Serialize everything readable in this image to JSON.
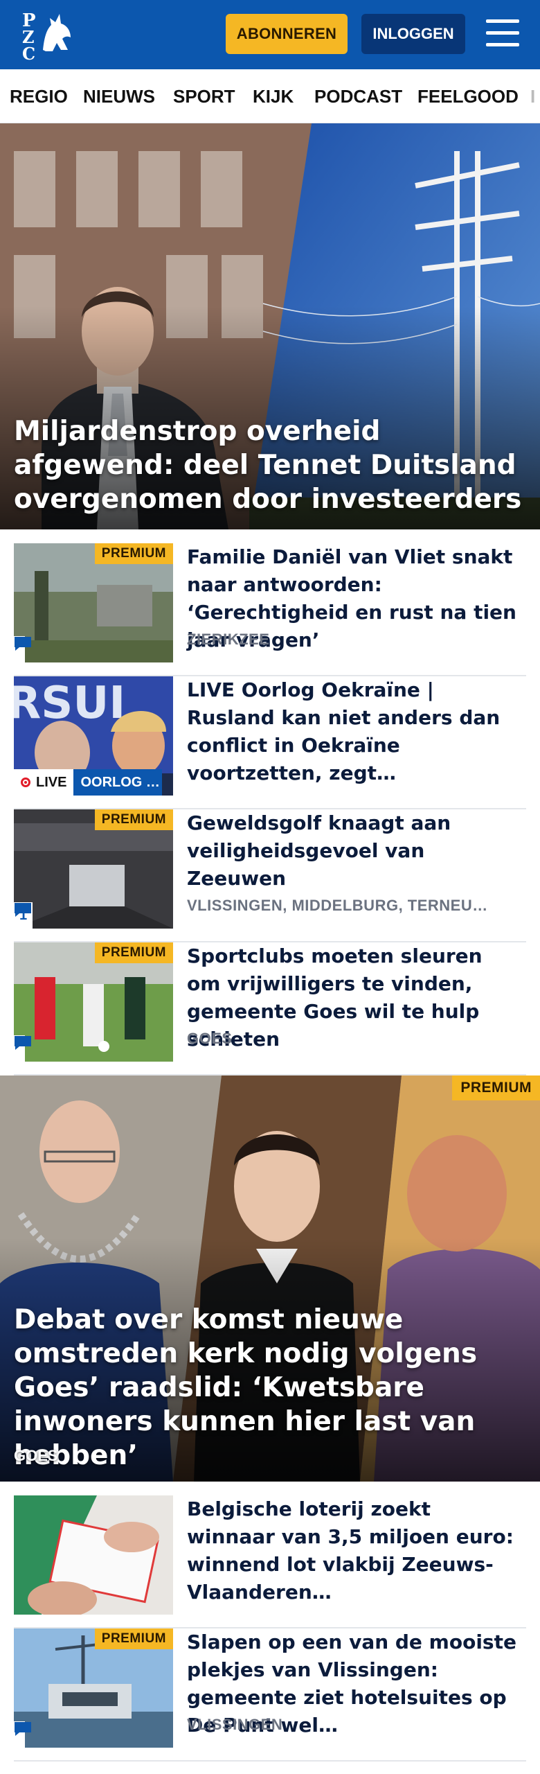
{
  "header": {
    "logo_text": "PZC",
    "subscribe_label": "ABONNEREN",
    "login_label": "INLOGGEN",
    "colors": {
      "brand": "#0c57ae",
      "accent": "#f5b724"
    }
  },
  "nav": {
    "items": [
      "REGIO",
      "NIEUWS",
      "SPORT",
      "KIJK",
      "PODCAST",
      "FEELGOOD",
      "I"
    ]
  },
  "hero1": {
    "title": "Miljardenstrop overheid afgewend: deel Tennet Duitsland overgenomen door investeerders"
  },
  "articles1": [
    {
      "title": "Familie Daniël van Vliet snakt naar antwoorden: ‘Gerechtigheid en rust na tien jaar vragen’",
      "location": "ZIERIKZEE",
      "premium": "PREMIUM",
      "comments": ""
    },
    {
      "title": "LIVE Oorlog Oekraïne | Rusland kan niet anders dan conflict in Oekraïne voortzetten, zegt…",
      "location": "",
      "live_label": "LIVE",
      "live_topic": "OORLOG …"
    },
    {
      "title": "Geweldsgolf knaagt aan veilig­heidsgevoel van Zeeuwen",
      "location": "VLISSINGEN, MIDDELBURG, TERNEU…",
      "premium": "PREMIUM",
      "comments": "1"
    },
    {
      "title": "Sportclubs moeten sleuren om vrijwilligers te vinden, gemeente Goes wil te hulp schieten",
      "location": "GOES",
      "premium": "PREMIUM",
      "comments": ""
    }
  ],
  "hero2": {
    "title": "Debat over komst nieuwe omstreden kerk nodig volgens Goes’ raadslid: ‘Kwetsbare inwoners kunnen hier last van hebben’",
    "location": "GOES",
    "premium": "PREMIUM"
  },
  "articles2": [
    {
      "title": "Belgische loterij zoekt winnaar van 3,5 miljoen euro: winnend lot vlakbij Zeeuws-Vlaanderen…",
      "location": ""
    },
    {
      "title": "Slapen op een van de mooiste plekjes van Vlissingen: gemeente ziet hotelsuites op De Punt wel…",
      "location": "VLISSINGEN",
      "premium": "PREMIUM",
      "comments": ""
    }
  ]
}
